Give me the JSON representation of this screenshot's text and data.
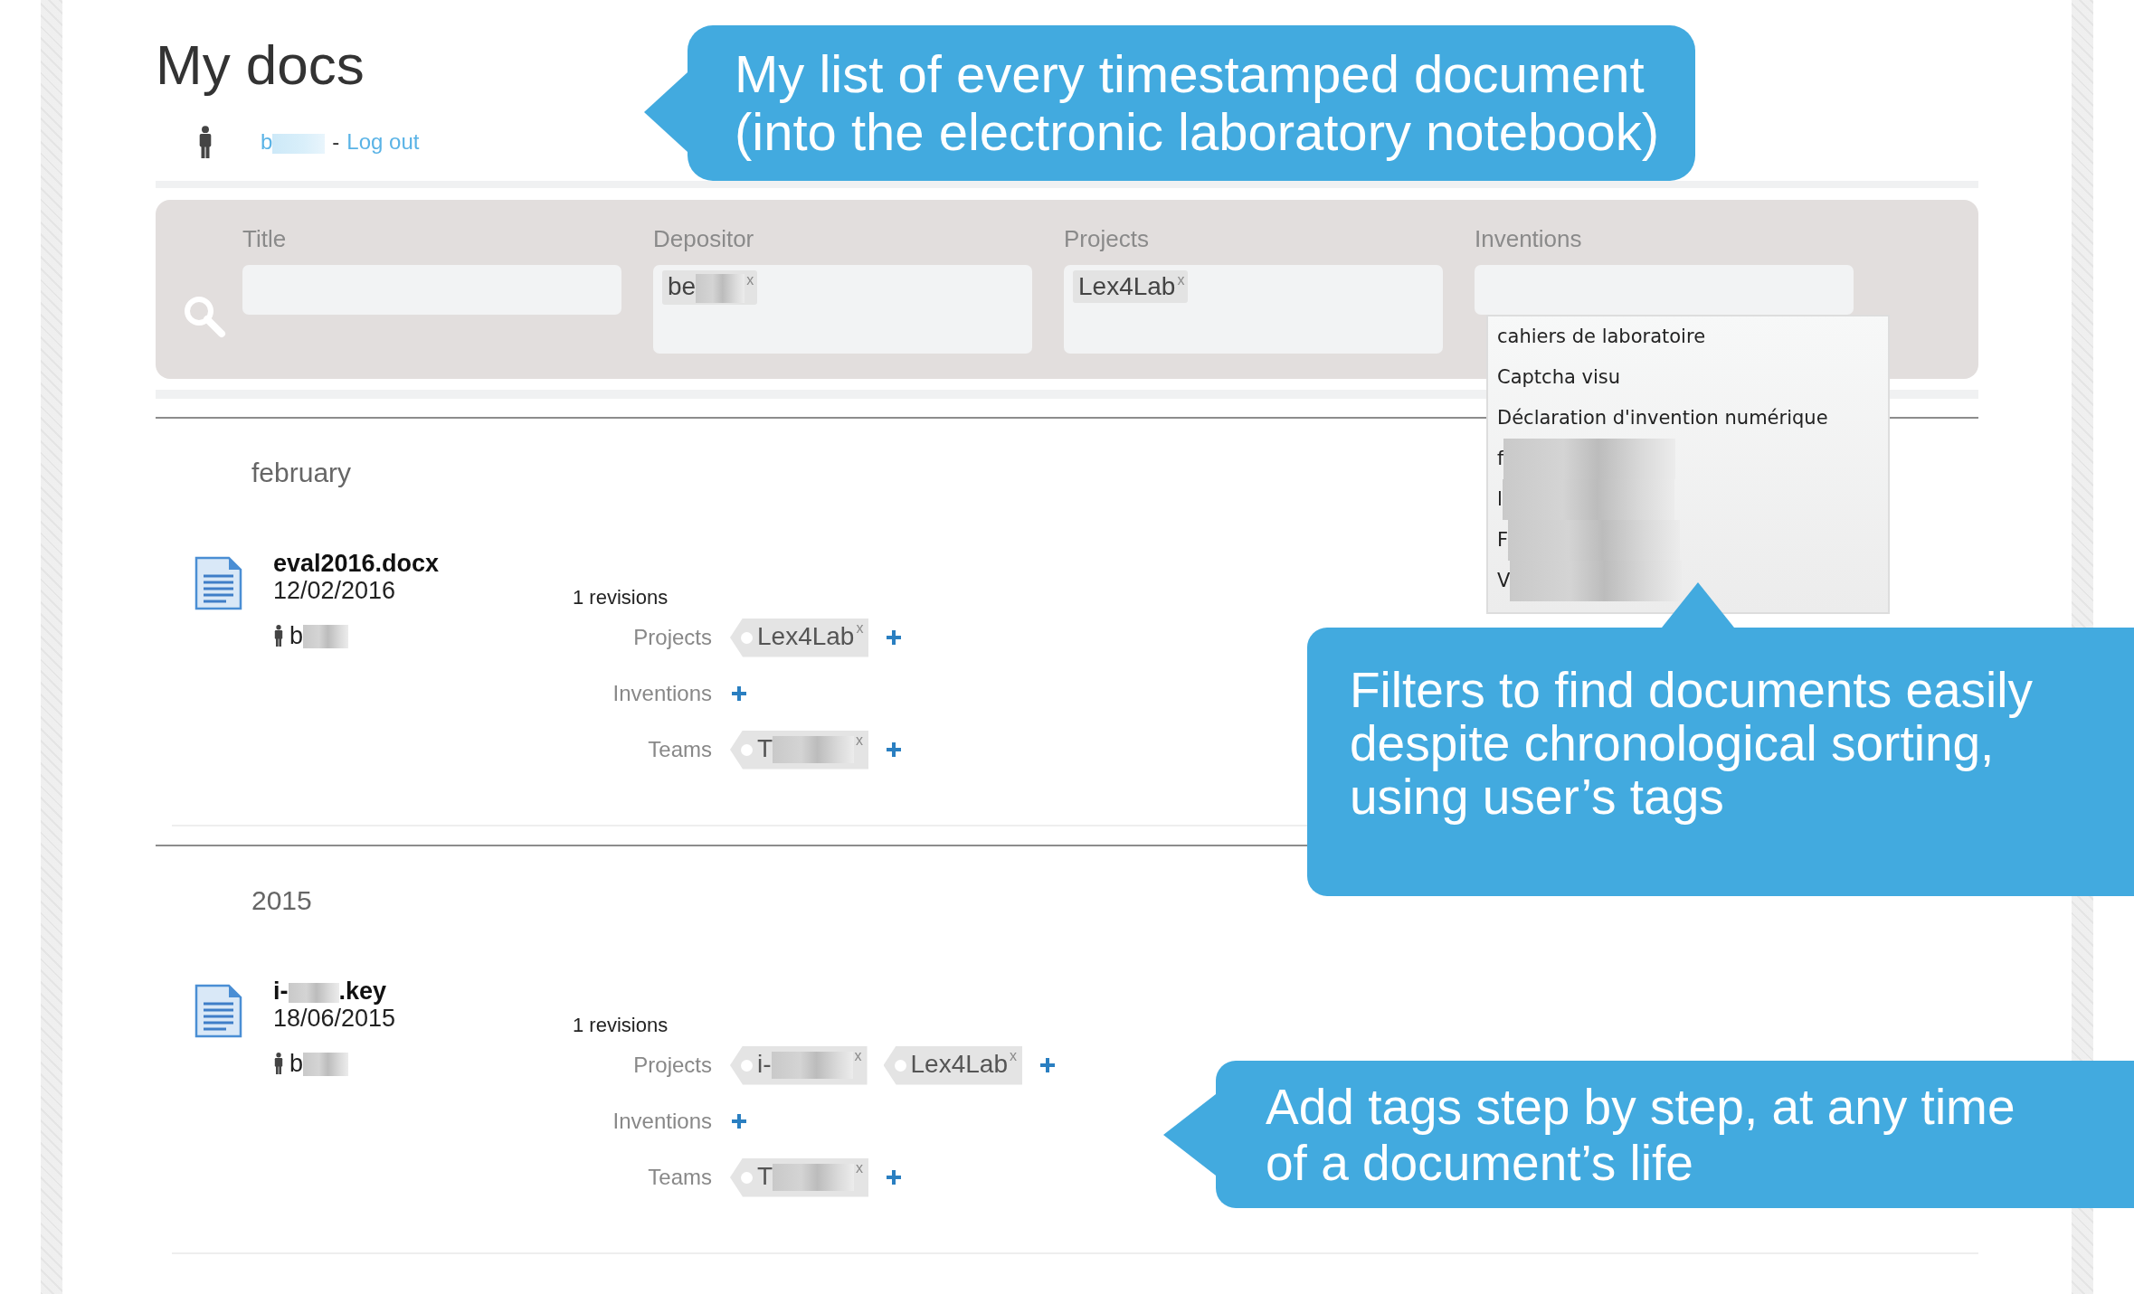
{
  "header": {
    "title": "My docs",
    "user": {
      "text": "b",
      "redacted": true
    },
    "separator": "-",
    "logout": "Log out"
  },
  "filters": [
    {
      "label": "Title",
      "kind": "text"
    },
    {
      "label": "Depositor",
      "kind": "tags",
      "tags": [
        {
          "text": "be",
          "redacted": true,
          "remove": "x"
        }
      ]
    },
    {
      "label": "Projects",
      "kind": "tags",
      "tags": [
        {
          "text": "Lex4Lab",
          "redacted": false,
          "remove": "x"
        }
      ]
    },
    {
      "label": "Inventions",
      "kind": "text",
      "suggestions": [
        {
          "text": "cahiers de laboratoire",
          "redacted": false
        },
        {
          "text": "Captcha visu",
          "redacted": false
        },
        {
          "text": "Déclaration d'invention numérique",
          "redacted": false
        },
        {
          "text": "f",
          "redacted": true
        },
        {
          "text": "l",
          "redacted": true
        },
        {
          "text": "F",
          "redacted": true
        },
        {
          "text": "V",
          "redacted": true
        }
      ]
    }
  ],
  "groups": [
    {
      "heading": "february",
      "docs": [
        {
          "filename": {
            "text": "eval2016.docx",
            "redacted": false
          },
          "date": "12/02/2016",
          "depositor": {
            "text": "b",
            "redacted": true
          },
          "revisions": "1 revisions",
          "tag_rows": [
            {
              "label": "Projects",
              "tags": [
                {
                  "text": "Lex4Lab",
                  "redacted": false,
                  "remove": "x"
                }
              ]
            },
            {
              "label": "Inventions"
            },
            {
              "label": "Teams",
              "tags": [
                {
                  "text": "T",
                  "redacted": true,
                  "remove": "x"
                }
              ]
            }
          ]
        }
      ]
    },
    {
      "heading": "2015",
      "docs": [
        {
          "filename": {
            "text": "i-",
            "redacted": true,
            "suffix": ".key"
          },
          "date": "18/06/2015",
          "depositor": {
            "text": "b",
            "redacted": true
          },
          "revisions": "1 revisions",
          "tag_rows": [
            {
              "label": "Projects",
              "tags": [
                {
                  "text": "i-",
                  "redacted": true,
                  "remove": "x"
                },
                {
                  "text": "Lex4Lab",
                  "redacted": false,
                  "remove": "x"
                }
              ]
            },
            {
              "label": "Inventions"
            },
            {
              "label": "Teams",
              "tags": [
                {
                  "text": "T",
                  "redacted": true,
                  "remove": "x"
                }
              ]
            }
          ]
        }
      ]
    }
  ],
  "callouts": [
    {
      "kind": "left",
      "lines": [
        "My list of every timestamped document",
        "(into the electronic laboratory notebook)"
      ]
    },
    {
      "kind": "up",
      "lines": [
        "Filters to find documents easily",
        "despite chronological sorting,",
        "using user’s tags"
      ]
    },
    {
      "kind": "left",
      "lines": [
        "Add tags step by step, at any time",
        "of a document’s life"
      ]
    }
  ]
}
